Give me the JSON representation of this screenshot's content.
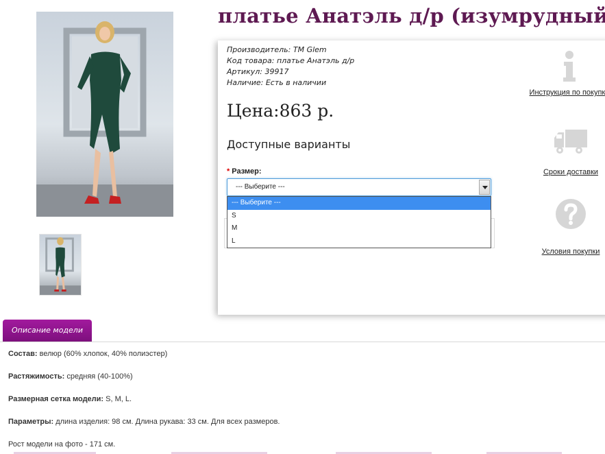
{
  "product": {
    "title": "платье Анатэль д/р (изумрудный)"
  },
  "meta": [
    {
      "label": "Производитель:",
      "value": "TM Glem"
    },
    {
      "label": "Код товара:",
      "value": "платье Анатэль д/р"
    },
    {
      "label": "Артикул:",
      "value": "39917"
    },
    {
      "label": "Наличие:",
      "value": "Есть в наличии"
    }
  ],
  "price": {
    "text": "Цена:863 р."
  },
  "options": {
    "title": "Доступные варианты",
    "size_label": "Размер:",
    "required_mark": "*",
    "selected": "--- Выберите ---",
    "items": [
      "--- Выберите ---",
      "S",
      "M",
      "L"
    ]
  },
  "side_links": [
    {
      "icon": "info-icon",
      "label": "Инструкция по покупке"
    },
    {
      "icon": "truck-icon",
      "label": "Сроки доставки"
    },
    {
      "icon": "question-icon",
      "label": "Условия покупки"
    }
  ],
  "tabs": [
    {
      "label": "Описание модели"
    }
  ],
  "description": [
    {
      "key": "Состав:",
      "value": " велюр (60% хлопок, 40% полиэстер)"
    },
    {
      "key": "Растяжимость:",
      "value": " средняя (40-100%)"
    },
    {
      "key": "Размерная сетка модели:",
      "value": " S, M, L."
    },
    {
      "key": "Параметры:",
      "value": " длина изделия: 98 см. Длина рукава: 33 см. Для всех размеров."
    },
    {
      "key": "",
      "value": "Рост модели на фото - 171 см."
    }
  ],
  "colors": {
    "title": "#5e1a52",
    "tab": "#8e1490",
    "select_focus": "#4f9cd9",
    "option_selected": "#3d8ef0",
    "icon_gray": "#d6d6d6"
  }
}
